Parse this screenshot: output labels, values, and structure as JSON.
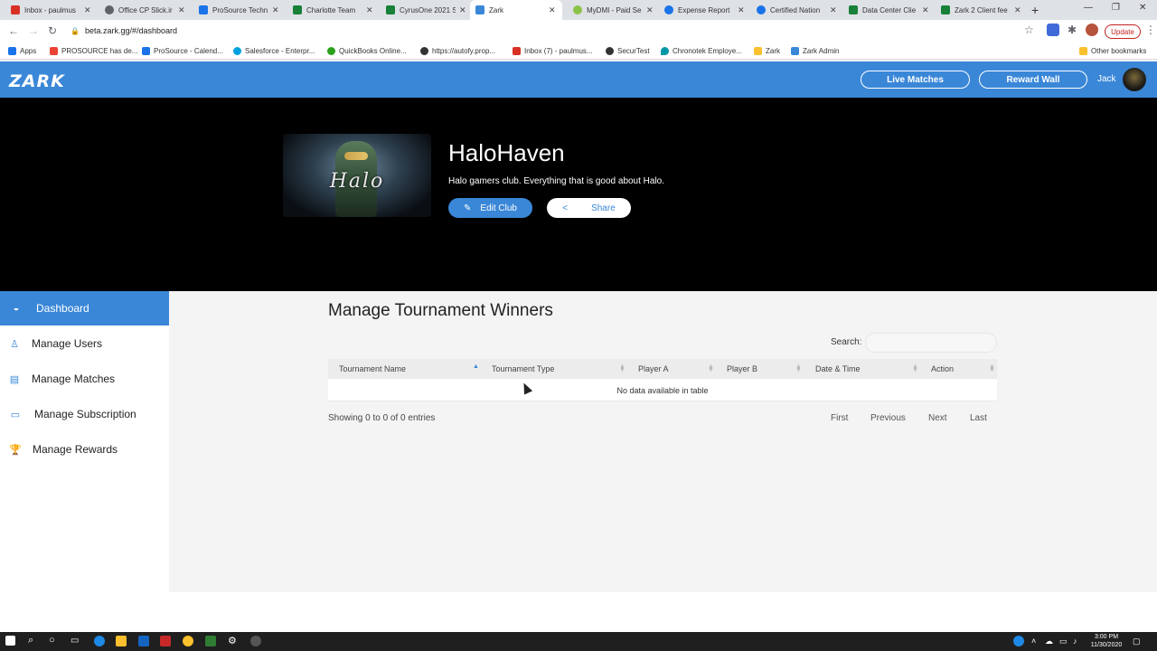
{
  "browser": {
    "tabs": [
      {
        "label": "Inbox - paulmus",
        "color": "#d93025"
      },
      {
        "label": "Office CP Slick.ir",
        "color": "#5f6368"
      },
      {
        "label": "ProSource Techn",
        "color": "#1a73e8"
      },
      {
        "label": "Charlotte Team",
        "color": "#188038"
      },
      {
        "label": "CyrusOne 2021 S",
        "color": "#188038"
      },
      {
        "label": "Zark",
        "color": "#3a87d8"
      },
      {
        "label": "MyDMI - Paid Se",
        "color": "#8bc34a"
      },
      {
        "label": "Expense Report",
        "color": "#1a73e8"
      },
      {
        "label": "Certified Nation",
        "color": "#1a73e8"
      },
      {
        "label": "Data Center Clie",
        "color": "#188038"
      },
      {
        "label": "Zark 2 Client fee",
        "color": "#188038"
      }
    ],
    "url": "beta.zark.gg/#/dashboard",
    "update_label": "Update",
    "bookmarks": [
      {
        "label": "Apps",
        "color": "#1a73e8"
      },
      {
        "label": "PROSOURCE has de...",
        "color": "#ea4335"
      },
      {
        "label": "ProSource - Calend...",
        "color": "#1a73e8"
      },
      {
        "label": "Salesforce - Enterpr...",
        "color": "#00a1e0"
      },
      {
        "label": "QuickBooks Online...",
        "color": "#2ca01c"
      },
      {
        "label": "https://autofy.prop...",
        "color": "#333333"
      },
      {
        "label": "Inbox (7) - paulmus...",
        "color": "#d93025"
      },
      {
        "label": "SecurTest",
        "color": "#333333"
      },
      {
        "label": "Chronotek Employe...",
        "color": "#0097a7"
      },
      {
        "label": "Zark",
        "color": "#fbc02d"
      },
      {
        "label": "Zark Admin",
        "color": "#3a87d8"
      }
    ],
    "other_bookmarks": "Other bookmarks"
  },
  "app": {
    "logo": "ZARK",
    "live_matches": "Live Matches",
    "reward_wall": "Reward Wall",
    "username": "Jack"
  },
  "club": {
    "image_text": "Halo",
    "title": "HaloHaven",
    "description": "Halo gamers club. Everything that is good about Halo.",
    "edit_label": "Edit Club",
    "share_label": "Share"
  },
  "sidebar": {
    "items": [
      {
        "label": "Dashboard",
        "icon": "dashboard-icon"
      },
      {
        "label": "Manage Users",
        "icon": "user-icon"
      },
      {
        "label": "Manage Matches",
        "icon": "document-icon"
      },
      {
        "label": "Manage Subscription",
        "icon": "credit-card-icon"
      },
      {
        "label": "Manage Rewards",
        "icon": "trophy-icon"
      }
    ]
  },
  "main": {
    "title": "Manage Tournament Winners",
    "search_label": "Search:",
    "search_value": "",
    "columns": [
      "Tournament Name",
      "Tournament Type",
      "Player A",
      "Player B",
      "Date & Time",
      "Action"
    ],
    "sorted_column": "Tournament Name",
    "empty_message": "No data available in table",
    "info": "Showing 0 to 0 of 0 entries",
    "pagination": [
      "First",
      "Previous",
      "Next",
      "Last"
    ]
  },
  "taskbar": {
    "time": "3:00 PM",
    "date": "11/30/2020"
  }
}
